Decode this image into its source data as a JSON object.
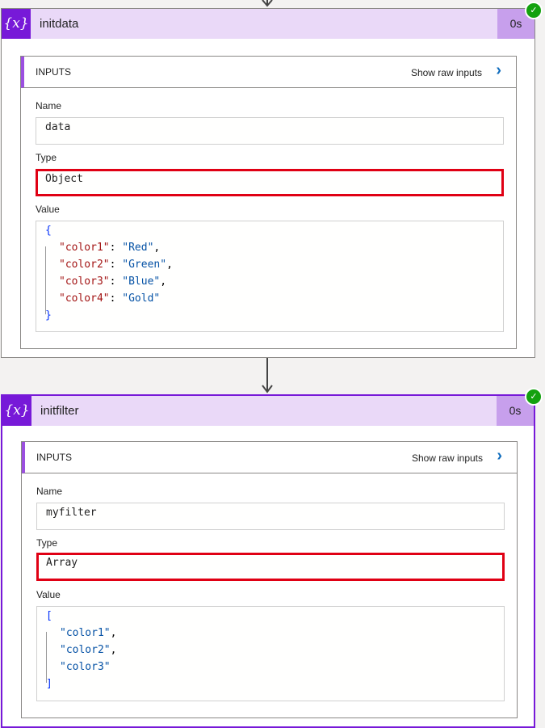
{
  "steps": [
    {
      "icon": "{x}",
      "title": "initdata",
      "duration": "0s",
      "status": "succeeded",
      "inputs_label": "INPUTS",
      "show_raw": "Show raw inputs",
      "name_label": "Name",
      "name_value": "data",
      "type_label": "Type",
      "type_value": "Object",
      "value_label": "Value",
      "value_open": "{",
      "value_close": "}",
      "value_lines": [
        {
          "key": "\"color1\"",
          "sep": ": ",
          "val": "\"Red\"",
          "end": ","
        },
        {
          "key": "\"color2\"",
          "sep": ": ",
          "val": "\"Green\"",
          "end": ","
        },
        {
          "key": "\"color3\"",
          "sep": ": ",
          "val": "\"Blue\"",
          "end": ","
        },
        {
          "key": "\"color4\"",
          "sep": ": ",
          "val": "\"Gold\"",
          "end": ""
        }
      ]
    },
    {
      "icon": "{x}",
      "title": "initfilter",
      "duration": "0s",
      "status": "succeeded",
      "inputs_label": "INPUTS",
      "show_raw": "Show raw inputs",
      "name_label": "Name",
      "name_value": "myfilter",
      "type_label": "Type",
      "type_value": "Array",
      "value_label": "Value",
      "value_open": "[",
      "value_close": "]",
      "value_lines": [
        {
          "val": "\"color1\"",
          "end": ","
        },
        {
          "val": "\"color2\"",
          "end": ","
        },
        {
          "val": "\"color3\"",
          "end": ""
        }
      ]
    }
  ]
}
